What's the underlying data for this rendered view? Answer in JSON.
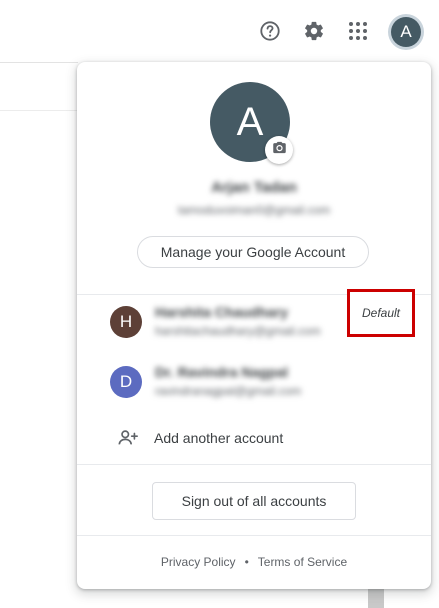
{
  "topbar": {
    "help_icon": "help-circle-icon",
    "settings_icon": "gear-icon",
    "apps_icon": "apps-grid-icon",
    "avatar_letter": "A"
  },
  "panel": {
    "avatar_letter": "A",
    "camera_icon": "camera-icon",
    "account_name": "Arjan Tadan",
    "account_email": "tamoduvoiman0@gmail.com",
    "manage_label": "Manage your Google Account",
    "accounts": [
      {
        "letter": "H",
        "name": "Harshita Chaudhary",
        "email": "harshitachaudhary@gmail.com",
        "avatar_color": "#5d4037",
        "badge": "Default"
      },
      {
        "letter": "D",
        "name": "Dr. Ravindra Nagpal",
        "email": "ravindranagpal@gmail.com",
        "avatar_color": "#5c6bc0"
      }
    ],
    "add_account_label": "Add another account",
    "add_account_icon": "person-add-icon",
    "sign_out_label": "Sign out of all accounts",
    "footer": {
      "privacy": "Privacy Policy",
      "separator": "•",
      "terms": "Terms of Service"
    }
  },
  "colors": {
    "badge_border": "#cc0000",
    "primary_avatar": "#455a64"
  }
}
